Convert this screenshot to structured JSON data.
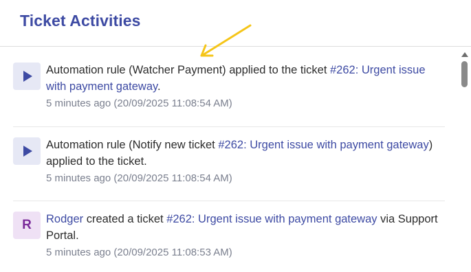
{
  "panel": {
    "title": "Ticket Activities"
  },
  "activities": [
    {
      "icon": "play-icon",
      "parts": [
        "Automation rule (Watcher Payment) applied to the ticket ",
        "#262: Urgent issue with payment gateway",
        "."
      ],
      "time": "5 minutes ago (20/09/2025 11:08:54 AM)"
    },
    {
      "icon": "play-icon",
      "parts": [
        "Automation rule (Notify new ticket ",
        "#262: Urgent issue with payment gateway",
        ") applied to the ticket."
      ],
      "time": "5 minutes ago (20/09/2025 11:08:54 AM)"
    },
    {
      "icon": "avatar-letter",
      "avatar_letter": "R",
      "user": "Rodger",
      "parts": [
        " created a ticket ",
        "#262: Urgent issue with payment gateway",
        " via Support Portal."
      ],
      "time": "5 minutes ago (20/09/2025 11:08:53 AM)"
    }
  ],
  "colors": {
    "accent": "#3d4aa3",
    "annotation_arrow": "#f5c518"
  }
}
